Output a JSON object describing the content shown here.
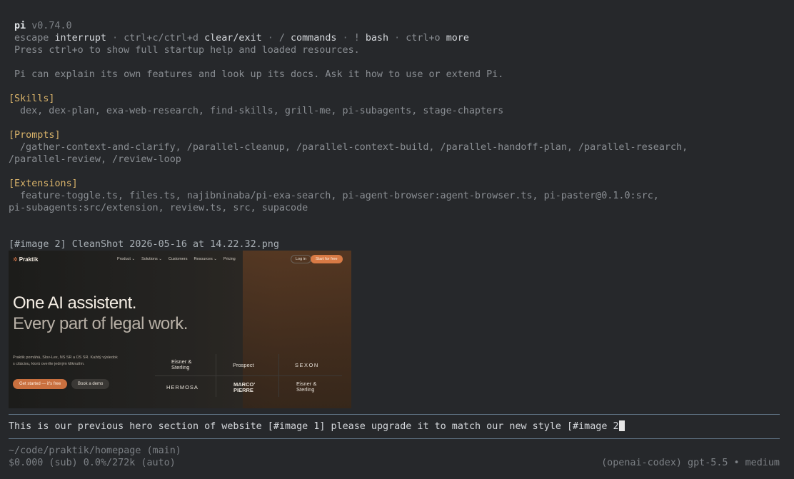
{
  "header": {
    "app_name": "pi",
    "version": "v0.74.0",
    "shortcuts": [
      {
        "key": "escape",
        "label": "interrupt"
      },
      {
        "key": "ctrl+c/ctrl+d",
        "label": "clear/exit"
      },
      {
        "key": "/",
        "label": "commands"
      },
      {
        "key": "!",
        "label": "bash"
      },
      {
        "key": "ctrl+o",
        "label": "more"
      }
    ],
    "separator": "·",
    "help_hint": "Press ctrl+o to show full startup help and loaded resources.",
    "intro": "Pi can explain its own features and look up its docs. Ask it how to use or extend Pi."
  },
  "sections": {
    "skills": {
      "title": "[Skills]",
      "items": "dex, dex-plan, exa-web-research, find-skills, grill-me, pi-subagents, stage-chapters"
    },
    "prompts": {
      "title": "[Prompts]",
      "line1": "/gather-context-and-clarify, /parallel-cleanup, /parallel-context-build, /parallel-handoff-plan, /parallel-research,",
      "line2": "/parallel-review, /review-loop"
    },
    "extensions": {
      "title": "[Extensions]",
      "line1": "feature-toggle.ts, files.ts, najibninaba/pi-exa-search, pi-agent-browser:agent-browser.ts, pi-paster@0.1.0:src,",
      "line2": "pi-subagents:src/extension, review.ts, src, supacode"
    }
  },
  "attachment": {
    "tag": "[#image 2]",
    "filename": "CleanShot 2026-05-16 at 14.22.32.png",
    "preview": {
      "logo": "Praktik",
      "nav": [
        "Product ⌄",
        "Solutions ⌄",
        "Customers",
        "Resources ⌄",
        "Pricing"
      ],
      "login": "Log in",
      "start": "Start for free",
      "headline1": "One AI assistent.",
      "headline2": "Every part of legal work.",
      "subtext": "Praktik pomáhá, Slov-Lex, NS SR a ÚS SR. Každý výsledok s citáciou, ktorú overíte jedným kliknutím.",
      "cta_primary": "Get started — it's free",
      "cta_secondary": "Book a demo",
      "brands": [
        "Eisner & Sterling",
        "Prospect",
        "SEXON",
        "HERMOSA",
        "MARCO' PIERRE",
        "Eisner & Sterling"
      ]
    }
  },
  "input": {
    "text": "This is our previous hero section of website [#image 1] please upgrade it to match our new style [#image 2"
  },
  "footer": {
    "path": "~/code/praktik/homepage (main)",
    "usage": "$0.000 (sub) 0.0%/272k (auto)",
    "model": "(openai-codex) gpt-5.5 • medium"
  },
  "colors": {
    "background": "#26282b",
    "section_header": "#d9b36a",
    "rule": "#5f7384",
    "accent_orange": "#d87a45"
  }
}
